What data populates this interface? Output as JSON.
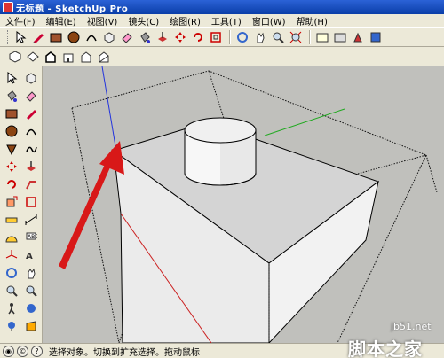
{
  "window": {
    "title": "无标题 - SketchUp Pro"
  },
  "menu": [
    "文件(F)",
    "编辑(E)",
    "视图(V)",
    "镜头(C)",
    "绘图(R)",
    "工具(T)",
    "窗口(W)",
    "帮助(H)"
  ],
  "toolbar_top": {
    "icons": [
      "select-arrow-icon",
      "pencil-icon",
      "rectangle-icon",
      "circle-icon",
      "arc-icon",
      "make-component-icon",
      "eraser-icon",
      "paint-bucket-icon",
      "push-pull-icon",
      "move-icon",
      "rotate-icon",
      "offset-icon",
      "orbit-icon",
      "pan-icon",
      "zoom-icon",
      "zoom-extents-icon",
      "model-info-icon",
      "warehouse-icon",
      "extension-icon",
      "share-model-icon"
    ]
  },
  "toolbar_views": {
    "icons": [
      "iso-view-icon",
      "top-view-icon",
      "front-view-icon",
      "right-view-icon",
      "back-view-icon",
      "left-view-icon"
    ]
  },
  "left_tools": {
    "icons": [
      "select-icon",
      "make-component-icon",
      "paint-bucket-icon",
      "eraser-icon",
      "rectangle-icon",
      "line-icon",
      "circle-icon",
      "arc-icon",
      "polygon-icon",
      "freehand-icon",
      "move-icon",
      "push-pull-icon",
      "rotate-icon",
      "follow-me-icon",
      "scale-icon",
      "offset-icon",
      "tape-measure-icon",
      "dimension-icon",
      "protractor-icon",
      "text-icon",
      "axes-icon",
      "3d-text-icon",
      "orbit-icon",
      "pan-icon",
      "zoom-icon",
      "zoom-window-icon",
      "walk-icon",
      "look-around-icon",
      "position-camera-icon",
      "section-plane-icon"
    ]
  },
  "status": {
    "text": "选择对象。切换到扩充选择。拖动鼠标"
  },
  "watermark": {
    "site": "jb51.net",
    "name": "脚本之家"
  }
}
